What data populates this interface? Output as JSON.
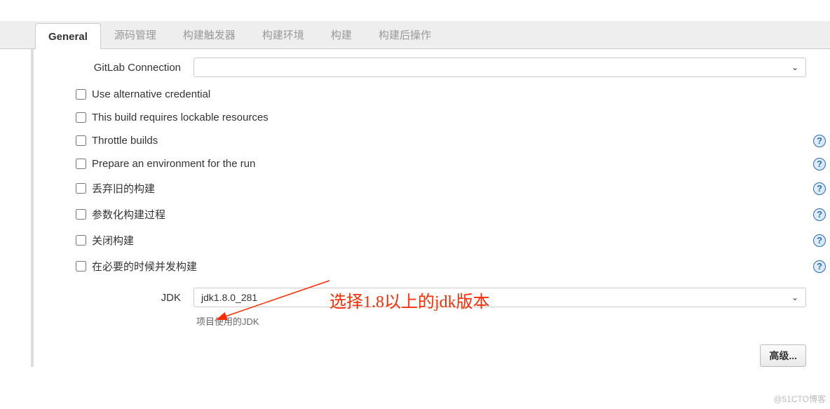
{
  "tabs": [
    {
      "label": "General",
      "active": true
    },
    {
      "label": "源码管理",
      "active": false
    },
    {
      "label": "构建触发器",
      "active": false
    },
    {
      "label": "构建环境",
      "active": false
    },
    {
      "label": "构建",
      "active": false
    },
    {
      "label": "构建后操作",
      "active": false
    }
  ],
  "form": {
    "gitlab_connection_label": "GitLab Connection",
    "gitlab_connection_value": "",
    "checkboxes": [
      {
        "label": "Use alternative credential",
        "help": false
      },
      {
        "label": "This build requires lockable resources",
        "help": false
      },
      {
        "label": "Throttle builds",
        "help": true
      },
      {
        "label": "Prepare an environment for the run",
        "help": true
      },
      {
        "label": "丢弃旧的构建",
        "help": true
      },
      {
        "label": "参数化构建过程",
        "help": true
      },
      {
        "label": "关闭构建",
        "help": true
      },
      {
        "label": "在必要的时候并发构建",
        "help": true
      }
    ],
    "jdk_label": "JDK",
    "jdk_value": "jdk1.8.0_281",
    "jdk_desc": "项目使用的JDK",
    "advanced_label": "高级..."
  },
  "annotation_text": "选择1.8以上的jdk版本",
  "watermark": "@51CTO博客"
}
